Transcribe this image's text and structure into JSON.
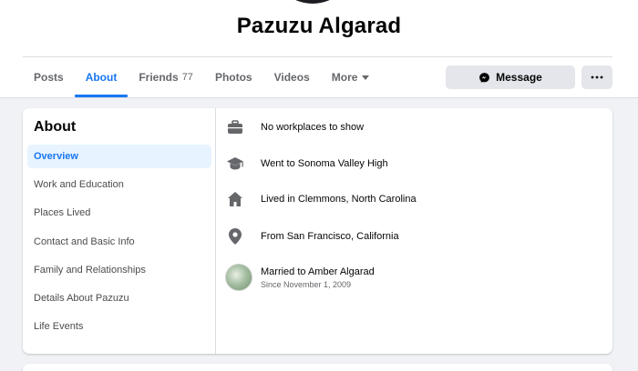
{
  "profile": {
    "name": "Pazuzu Algarad"
  },
  "tabs": [
    {
      "label": "Posts"
    },
    {
      "label": "About"
    },
    {
      "label": "Friends",
      "count": "77"
    },
    {
      "label": "Photos"
    },
    {
      "label": "Videos"
    },
    {
      "label": "More"
    }
  ],
  "actions": {
    "message_label": "Message"
  },
  "about": {
    "title": "About",
    "sidebar": [
      {
        "label": "Overview"
      },
      {
        "label": "Work and Education"
      },
      {
        "label": "Places Lived"
      },
      {
        "label": "Contact and Basic Info"
      },
      {
        "label": "Family and Relationships"
      },
      {
        "label": "Details About Pazuzu"
      },
      {
        "label": "Life Events"
      }
    ],
    "overview": {
      "work": "No workplaces to show",
      "education": "Went to Sonoma Valley High",
      "lived": "Lived in Clemmons, North Carolina",
      "from": "From San Francisco, California",
      "relationship": "Married to Amber Algarad",
      "relationship_since": "Since November 1, 2009"
    }
  },
  "colors": {
    "accent": "#1877f2",
    "active_bg": "#e7f3ff",
    "icon_gray": "#65676b",
    "page_bg": "#f0f2f5"
  },
  "icons": [
    "briefcase-icon",
    "graduation-cap-icon",
    "home-icon",
    "location-pin-icon",
    "messenger-icon",
    "more-dots-icon"
  ]
}
